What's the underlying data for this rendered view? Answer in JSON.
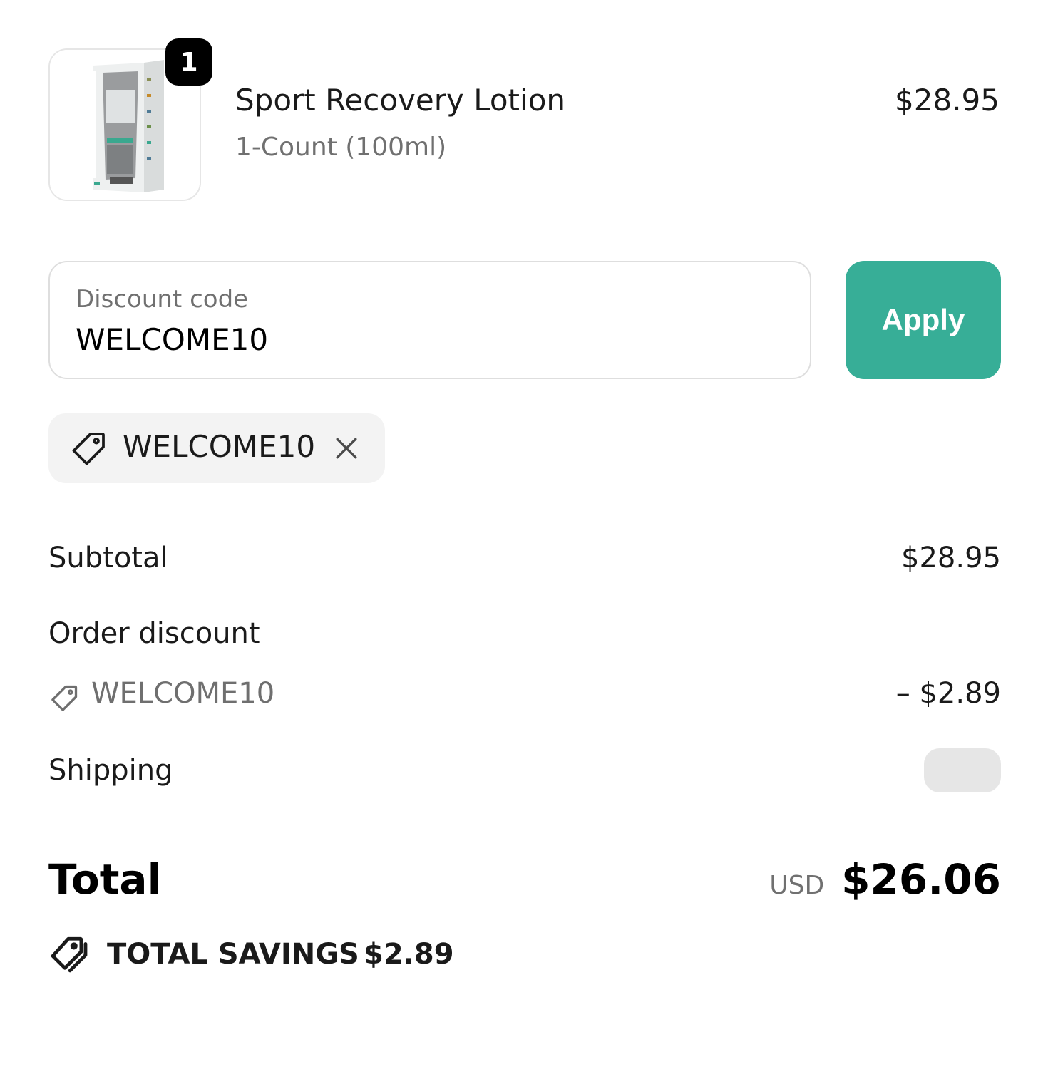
{
  "line_item": {
    "name": "Sport Recovery Lotion",
    "variant": "1-Count (100ml)",
    "price": "$28.95",
    "quantity": "1",
    "image_icon": "product-box-image"
  },
  "discount_form": {
    "label": "Discount code",
    "value": "WELCOME10",
    "apply_label": "Apply"
  },
  "applied_codes": [
    {
      "code": "WELCOME10",
      "icon": "tag-icon",
      "remove_icon": "close-icon"
    }
  ],
  "summary": {
    "subtotal_label": "Subtotal",
    "subtotal_value": "$28.95",
    "order_discount_label": "Order discount",
    "discount_code": "WELCOME10",
    "discount_amount": "– $2.89",
    "shipping_label": "Shipping"
  },
  "total": {
    "label": "Total",
    "currency": "USD",
    "value": "$26.06"
  },
  "savings": {
    "label": "TOTAL SAVINGS",
    "value": "$2.89",
    "icon": "tags-icon"
  },
  "colors": {
    "accent": "#37ae97",
    "badge": "#000000",
    "chip_background": "#f3f3f3",
    "muted_text": "#707070"
  }
}
